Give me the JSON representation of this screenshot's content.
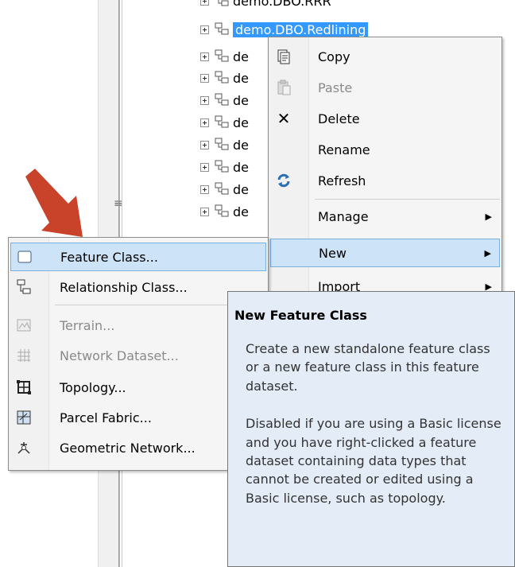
{
  "tree": {
    "selected_label": "demo.DBO.Redlining",
    "partial_label": "de",
    "truncated_top_label": "demo.DBO.RRR"
  },
  "context_menu": {
    "items": [
      {
        "label": "Copy",
        "icon": "copy-icon",
        "enabled": true
      },
      {
        "label": "Paste",
        "icon": "paste-icon",
        "enabled": false
      },
      {
        "label": "Delete",
        "icon": "delete-x-icon",
        "enabled": true
      },
      {
        "label": "Rename",
        "icon": "",
        "enabled": true
      },
      {
        "label": "Refresh",
        "icon": "refresh-icon",
        "enabled": true
      },
      {
        "label": "Manage",
        "icon": "",
        "enabled": true,
        "submenu": true
      },
      {
        "label": "New",
        "icon": "",
        "enabled": true,
        "submenu": true,
        "highlighted": true
      },
      {
        "label": "Import",
        "icon": "",
        "enabled": true,
        "submenu": true
      }
    ]
  },
  "new_submenu": {
    "items": [
      {
        "label": "Feature Class...",
        "icon": "feature-class-icon",
        "enabled": true,
        "highlighted": true
      },
      {
        "label": "Relationship Class...",
        "icon": "relationship-class-icon",
        "enabled": true
      },
      {
        "label": "Terrain...",
        "icon": "terrain-icon",
        "enabled": false
      },
      {
        "label": "Network Dataset...",
        "icon": "network-dataset-icon",
        "enabled": false
      },
      {
        "label": "Topology...",
        "icon": "topology-icon",
        "enabled": true
      },
      {
        "label": "Parcel Fabric...",
        "icon": "parcel-fabric-icon",
        "enabled": true
      },
      {
        "label": "Geometric Network...",
        "icon": "geometric-network-icon",
        "enabled": true
      }
    ]
  },
  "tooltip": {
    "title": "New Feature Class",
    "paragraph1": "Create a new standalone feature class or a new feature class in this feature dataset.",
    "paragraph2": "Disabled if you are using a Basic license and you have right-clicked a feature dataset containing data types that cannot be created or edited using a Basic license, such as topology."
  },
  "colors": {
    "selection_blue": "#3399ff",
    "menu_highlight": "#cde3f7",
    "tooltip_bg": "#e4ecf7",
    "arrow_red": "#c8432a"
  }
}
